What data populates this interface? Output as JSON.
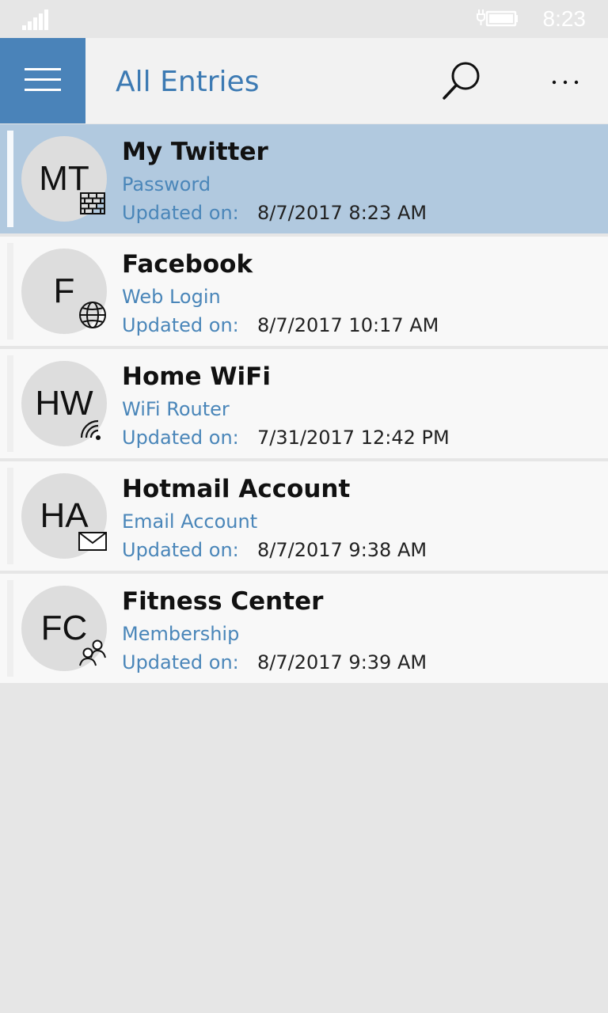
{
  "status_bar": {
    "signal_icon": "signal-strength-icon",
    "battery_icon": "battery-charging-icon",
    "time": "8:23"
  },
  "app_bar": {
    "title": "All Entries",
    "menu_icon": "hamburger-menu-icon",
    "search_icon": "search-icon",
    "more_icon": "more-options-icon",
    "accent_color": "#4a83b9"
  },
  "entries": [
    {
      "initials": "MT",
      "title": "My Twitter",
      "type": "Password",
      "updated_label": "Updated on:",
      "updated": "8/7/2017 8:23 AM",
      "icon": "brick-wall-icon",
      "selected": true
    },
    {
      "initials": "F",
      "title": "Facebook",
      "type": "Web Login",
      "updated_label": "Updated on:",
      "updated": "8/7/2017 10:17 AM",
      "icon": "globe-icon",
      "selected": false
    },
    {
      "initials": "HW",
      "title": "Home WiFi",
      "type": "WiFi Router",
      "updated_label": "Updated on:",
      "updated": "7/31/2017 12:42 PM",
      "icon": "wifi-icon",
      "selected": false
    },
    {
      "initials": "HA",
      "title": "Hotmail Account",
      "type": "Email Account",
      "updated_label": "Updated on:",
      "updated": "8/7/2017 9:38 AM",
      "icon": "envelope-icon",
      "selected": false
    },
    {
      "initials": "FC",
      "title": "Fitness Center",
      "type": "Membership",
      "updated_label": "Updated on:",
      "updated": "8/7/2017 9:39 AM",
      "icon": "people-icon",
      "selected": false
    }
  ]
}
